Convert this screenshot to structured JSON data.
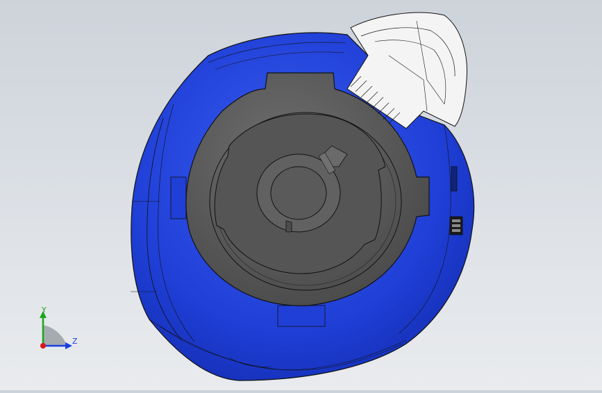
{
  "viewport": {
    "colors": {
      "background_top": "#cdd3da",
      "background_bottom": "#e9ebee",
      "housing_blue": "#1f3fd6",
      "housing_blue_dark": "#1530b8",
      "housing_blue_light": "#3a5cf0",
      "insert_gray": "#5c5c5c",
      "insert_gray_dark": "#4a4a4a",
      "insert_gray_light": "#6e6e6e",
      "cap_white": "#f4f4f4",
      "edge_black": "#111111"
    }
  },
  "triad": {
    "y_label": "Y",
    "z_label": "Z",
    "colors": {
      "y_axis": "#1aa51a",
      "z_axis": "#1a3fe0",
      "x_origin": "#d81818",
      "plane": "#9aa0a6"
    }
  }
}
